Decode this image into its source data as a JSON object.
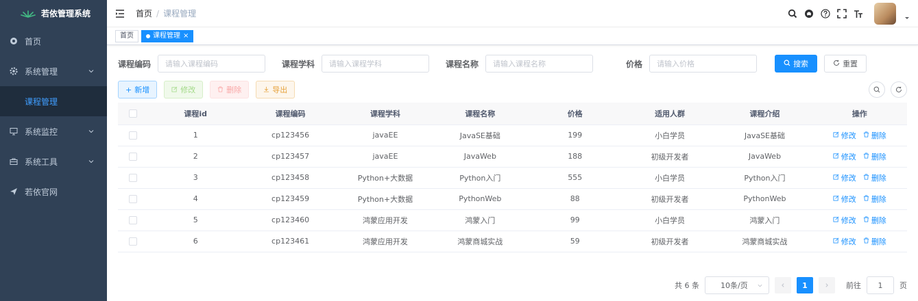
{
  "sidebar": {
    "logo_text": "若依管理系统",
    "items": [
      {
        "label": "首页",
        "icon": "dashboard-icon"
      },
      {
        "label": "系统管理",
        "icon": "gear-icon",
        "expandable": true
      },
      {
        "label": "课程管理",
        "sub": true,
        "active": true
      },
      {
        "label": "系统监控",
        "icon": "monitor-icon",
        "expandable": true
      },
      {
        "label": "系统工具",
        "icon": "toolbox-icon",
        "expandable": true
      },
      {
        "label": "若依官网",
        "icon": "send-icon"
      }
    ]
  },
  "navbar": {
    "breadcrumb": {
      "home": "首页",
      "separator": "/",
      "current": "课程管理"
    },
    "icons": [
      "search-icon",
      "github-icon",
      "question-icon",
      "fullscreen-icon",
      "font-size-icon"
    ]
  },
  "tags": [
    {
      "label": "首页",
      "active": false
    },
    {
      "label": "课程管理",
      "active": true,
      "close": "×"
    }
  ],
  "search": {
    "fields": [
      {
        "label": "课程编码",
        "placeholder": "请输入课程编码"
      },
      {
        "label": "课程学科",
        "placeholder": "请输入课程学科"
      },
      {
        "label": "课程名称",
        "placeholder": "请输入课程名称"
      },
      {
        "label": "价格",
        "placeholder": "请输入价格"
      }
    ],
    "search_label": "搜索",
    "reset_label": "重置"
  },
  "toolbar": {
    "add_label": "新增",
    "edit_label": "修改",
    "delete_label": "删除",
    "export_label": "导出"
  },
  "table": {
    "columns": [
      "课程id",
      "课程编码",
      "课程学科",
      "课程名称",
      "价格",
      "适用人群",
      "课程介绍",
      "操作"
    ],
    "rows": [
      {
        "id": "1",
        "code": "cp123456",
        "subject": "javaEE",
        "name": "JavaSE基础",
        "price": "199",
        "audience": "小白学员",
        "intro": "JavaSE基础"
      },
      {
        "id": "2",
        "code": "cp123457",
        "subject": "javaEE",
        "name": "JavaWeb",
        "price": "188",
        "audience": "初级开发者",
        "intro": "JavaWeb"
      },
      {
        "id": "3",
        "code": "cp123458",
        "subject": "Python+大数据",
        "name": "Python入门",
        "price": "555",
        "audience": "小白学员",
        "intro": "Python入门"
      },
      {
        "id": "4",
        "code": "cp123459",
        "subject": "Python+大数据",
        "name": "PythonWeb",
        "price": "88",
        "audience": "初级开发者",
        "intro": "PythonWeb"
      },
      {
        "id": "5",
        "code": "cp123460",
        "subject": "鸿蒙应用开发",
        "name": "鸿蒙入门",
        "price": "99",
        "audience": "小白学员",
        "intro": "鸿蒙入门"
      },
      {
        "id": "6",
        "code": "cp123461",
        "subject": "鸿蒙应用开发",
        "name": "鸿蒙商城实战",
        "price": "59",
        "audience": "初级开发者",
        "intro": "鸿蒙商城实战"
      }
    ],
    "op_edit": "修改",
    "op_delete": "删除"
  },
  "pagination": {
    "total": "共 6 条",
    "page_size": "10条/页",
    "current_page": "1",
    "goto_prefix": "前往",
    "goto_value": "1",
    "goto_suffix": "页"
  },
  "colors": {
    "sidebar_bg": "#304156",
    "primary": "#1890ff"
  }
}
